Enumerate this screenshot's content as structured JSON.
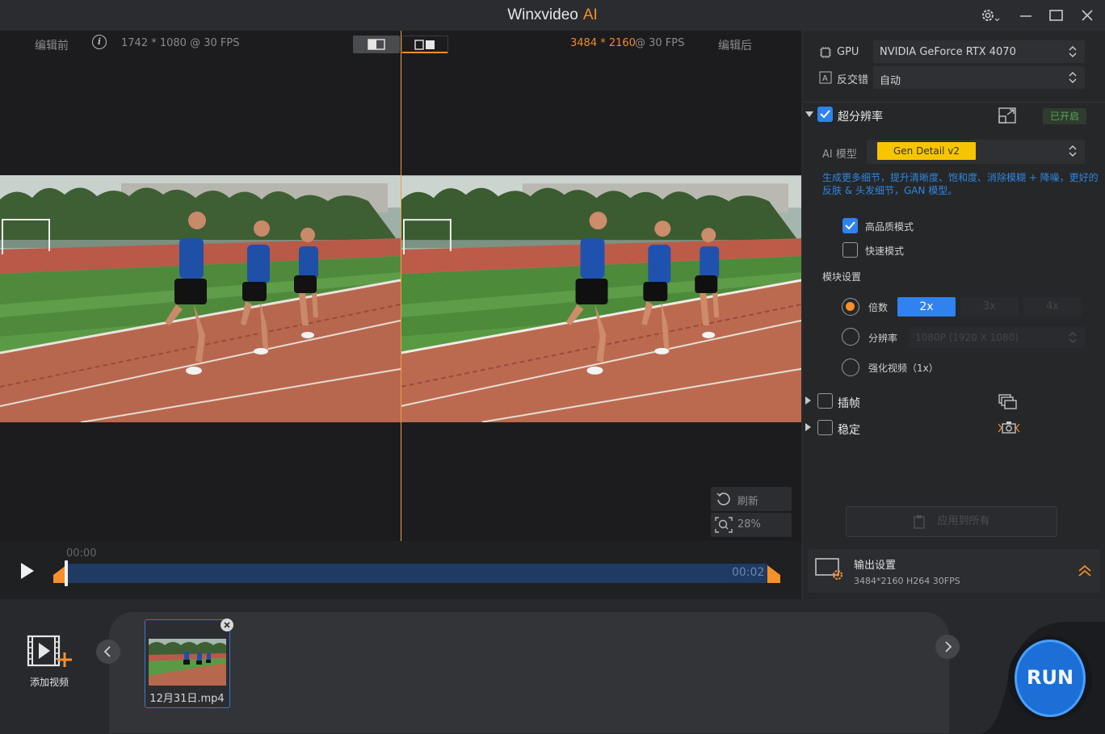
{
  "titlebar": {
    "title": "Winxvideo",
    "title_suffix": "AI"
  },
  "preview": {
    "before_label": "编辑前",
    "before_info": "1742 * 1080 @ 30 FPS",
    "after_res": "3484 * 2160",
    "after_fps": "@ 30 FPS",
    "after_label": "编辑后",
    "refresh_label": "刷新",
    "zoom_label": "28%"
  },
  "timeline": {
    "start_time": "00:00",
    "end_time": "00:02"
  },
  "panel": {
    "gpu_label": "GPU",
    "gpu_value": "NVIDIA GeForce RTX 4070",
    "deinterlace_label": "反交错",
    "deinterlace_value": "自动",
    "sr_label": "超分辨率",
    "sr_status": "已开启",
    "ai_model_label": "AI 模型",
    "ai_model_value": "Gen Detail v2",
    "description": "生成更多细节，提升清晰度、饱和度、消除模糊 + 降噪，更好的反肤 & 头发细节，GAN 模型。",
    "hq_label": "高品质模式",
    "fast_label": "快速模式",
    "module_label": "模块设置",
    "scale_label": "倍数",
    "scale_options": [
      "2x",
      "3x",
      "4x"
    ],
    "resolution_label": "分辨率",
    "resolution_value": "1080P (1920 X 1080)",
    "enhance_label": "强化视频（1x）",
    "interp_label": "插帧",
    "stabilize_label": "稳定",
    "apply_label": "应用到所有",
    "output_title": "输出设置",
    "output_info": "3484*2160  H264  30FPS"
  },
  "bottom": {
    "add_video_label": "添加视频",
    "file_name": "12月31日.mp4",
    "run_label": "RUN"
  }
}
